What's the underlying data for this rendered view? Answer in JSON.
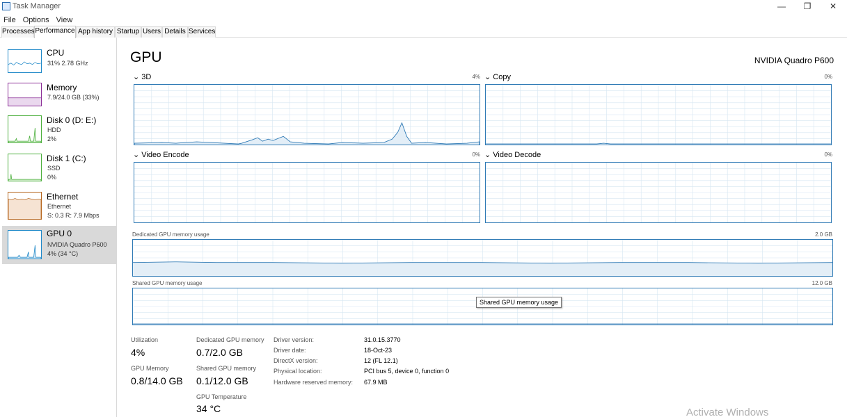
{
  "window": {
    "title": "Task Manager",
    "minimize": "—",
    "maximize": "❐",
    "close": "✕"
  },
  "menu": [
    "File",
    "Options",
    "View"
  ],
  "tabs": [
    {
      "label": "Processes"
    },
    {
      "label": "Performance",
      "active": true
    },
    {
      "label": "App history"
    },
    {
      "label": "Startup"
    },
    {
      "label": "Users"
    },
    {
      "label": "Details"
    },
    {
      "label": "Services"
    }
  ],
  "sidebar": {
    "items": [
      {
        "title": "CPU",
        "lines": [
          "31% 2.78 GHz"
        ],
        "color": "#1e88c8"
      },
      {
        "title": "Memory",
        "lines": [
          "7.9/24.0 GB (33%)"
        ],
        "color": "#8b2d96"
      },
      {
        "title": "Disk 0 (D: E:)",
        "lines": [
          "HDD",
          "2%"
        ],
        "color": "#4caf3d"
      },
      {
        "title": "Disk 1 (C:)",
        "lines": [
          "SSD",
          "0%"
        ],
        "color": "#4caf3d"
      },
      {
        "title": "Ethernet",
        "lines": [
          "Ethernet",
          "S: 0.3  R: 7.9 Mbps"
        ],
        "color": "#b5651d"
      },
      {
        "title": "GPU 0",
        "lines": [
          "NVIDIA Quadro P600",
          "4% (34 °C)"
        ],
        "color": "#1e88c8",
        "selected": true
      }
    ]
  },
  "main": {
    "title": "GPU",
    "model": "NVIDIA Quadro P600",
    "engines": [
      {
        "label": "3D",
        "percent": "4%"
      },
      {
        "label": "Copy",
        "percent": "0%"
      },
      {
        "label": "Video Encode",
        "percent": "0%"
      },
      {
        "label": "Video Decode",
        "percent": "0%"
      }
    ],
    "dedicated": {
      "label": "Dedicated GPU memory usage",
      "max": "2.0 GB"
    },
    "shared": {
      "label": "Shared GPU memory usage",
      "max": "12.0 GB"
    },
    "tooltip": "Shared GPU memory usage",
    "chevron": "⌄"
  },
  "stats": {
    "utilization": {
      "label": "Utilization",
      "value": "4%"
    },
    "dedicated_memory": {
      "label": "Dedicated GPU memory",
      "value": "0.7/2.0 GB"
    },
    "gpu_memory": {
      "label": "GPU Memory",
      "value": "0.8/14.0 GB"
    },
    "shared_memory": {
      "label": "Shared GPU memory",
      "value": "0.1/12.0 GB"
    },
    "temperature": {
      "label": "GPU Temperature",
      "value": "34 °C"
    }
  },
  "info": [
    {
      "label": "Driver version:",
      "value": "31.0.15.3770"
    },
    {
      "label": "Driver date:",
      "value": "18-Oct-23"
    },
    {
      "label": "DirectX version:",
      "value": "12 (FL 12.1)"
    },
    {
      "label": "Physical location:",
      "value": "PCI bus 5, device 0, function 0"
    },
    {
      "label": "Hardware reserved memory:",
      "value": "67.9 MB"
    }
  ],
  "watermark": "Activate Windows",
  "colors": {
    "accent": "#2f7ab5",
    "grid": "#d6e6f2"
  }
}
